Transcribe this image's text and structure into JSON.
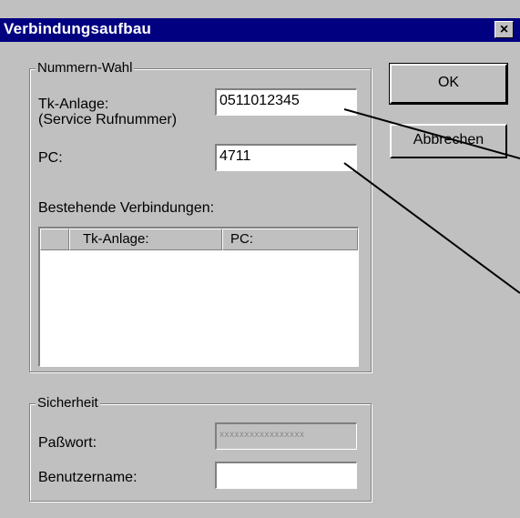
{
  "window": {
    "title": "Verbindungsaufbau",
    "close_glyph": "×"
  },
  "nummern_wahl": {
    "legend": "Nummern-Wahl",
    "tk_label": "Tk-Anlage:",
    "tk_sublabel": "(Service Rufnummer)",
    "tk_value": "0511012345",
    "pc_label": "PC:",
    "pc_value": "4711",
    "connections_label": "Bestehende Verbindungen:",
    "columns": [
      "",
      "Tk-Anlage:",
      "PC:"
    ]
  },
  "sicherheit": {
    "legend": "Sicherheit",
    "password_label": "Paßwort:",
    "password_value": "xxxxxxxxxxxxxxxxx",
    "username_label": "Benutzername:",
    "username_value": ""
  },
  "buttons": {
    "ok": "OK",
    "cancel": "Abbrechen"
  },
  "colors": {
    "titlebar": "#000080",
    "face": "#c0c0c0",
    "field": "#ffffff"
  }
}
